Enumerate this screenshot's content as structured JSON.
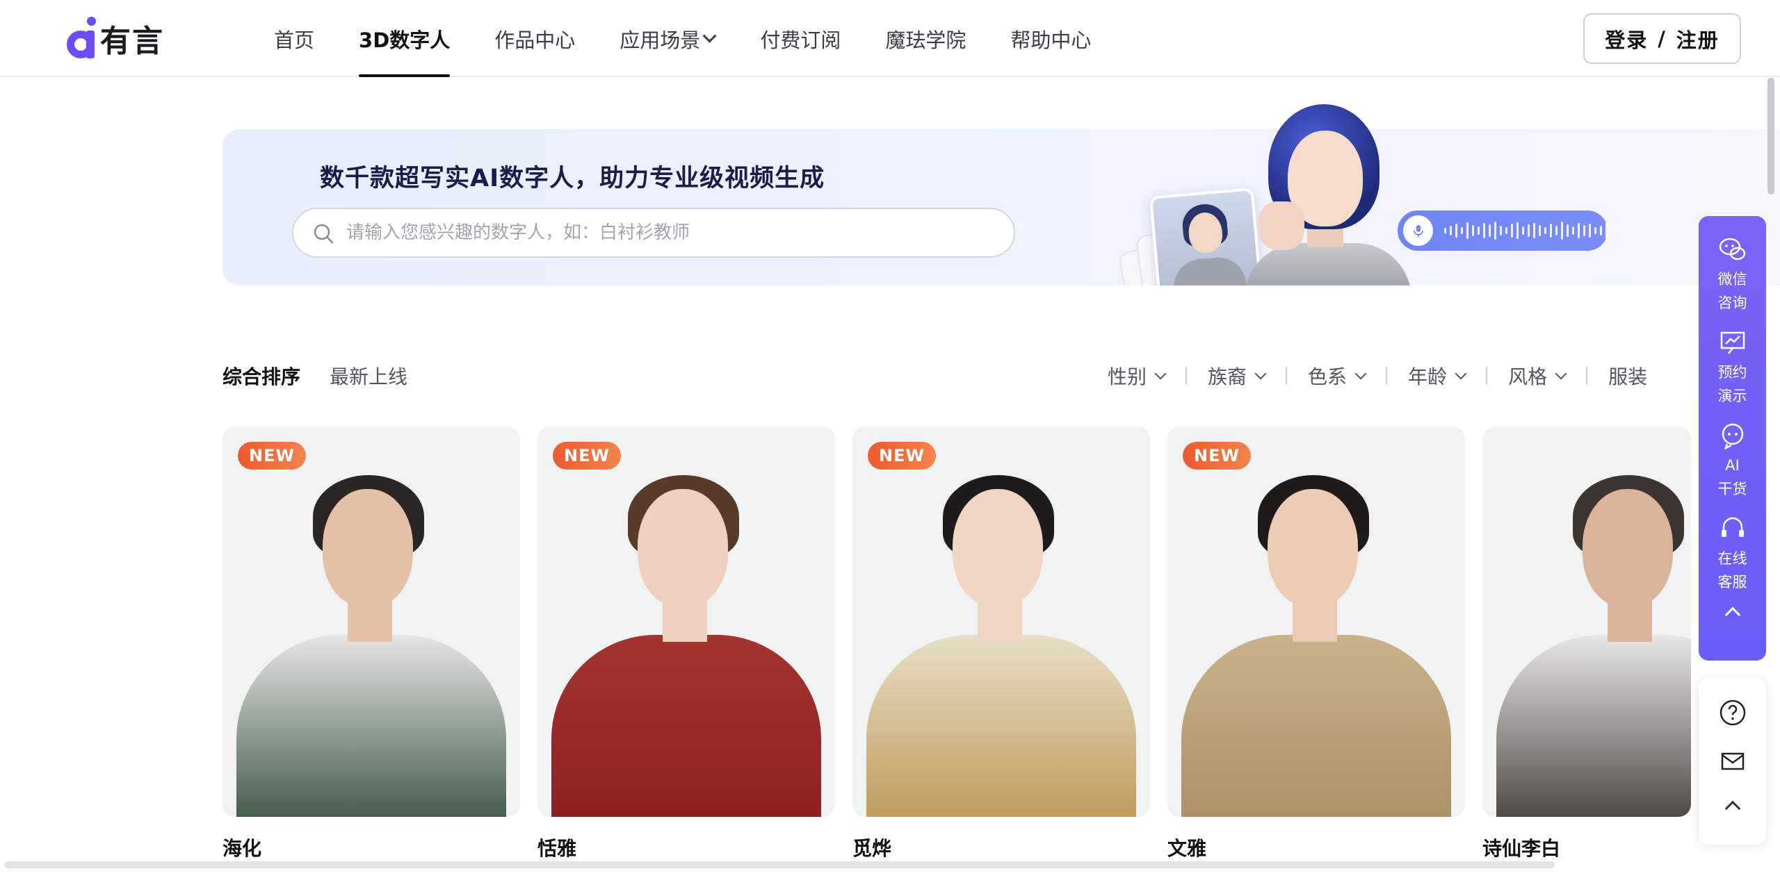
{
  "brand": {
    "name": "有言",
    "accent": "#6d4cf6"
  },
  "nav": {
    "items": [
      {
        "label": "首页",
        "active": false,
        "dropdown": false
      },
      {
        "label": "3D数字人",
        "active": true,
        "dropdown": false
      },
      {
        "label": "作品中心",
        "active": false,
        "dropdown": false
      },
      {
        "label": "应用场景",
        "active": false,
        "dropdown": true
      },
      {
        "label": "付费订阅",
        "active": false,
        "dropdown": false
      },
      {
        "label": "魔珐学院",
        "active": false,
        "dropdown": false
      },
      {
        "label": "帮助中心",
        "active": false,
        "dropdown": false
      }
    ],
    "login": {
      "login_label": "登录",
      "separator": "/",
      "register_label": "注册"
    }
  },
  "banner": {
    "title": "数千款超写实AI数字人，助力专业级视频生成",
    "search": {
      "placeholder": "请输入您感兴趣的数字人，如：白衬衫教师",
      "value": ""
    }
  },
  "sort": {
    "options": [
      {
        "label": "综合排序",
        "active": true
      },
      {
        "label": "最新上线",
        "active": false
      }
    ]
  },
  "filters": [
    "性别",
    "族裔",
    "色系",
    "年龄",
    "风格",
    "服装"
  ],
  "cards": [
    {
      "name": "海化",
      "badge": "NEW",
      "skin": "#e3c0a6",
      "hair": "#2b2623",
      "outfit": "#e6e6e2",
      "accent": "#2d4a3a"
    },
    {
      "name": "恬雅",
      "badge": "NEW",
      "skin": "#efcfbd",
      "hair": "#5a3a28",
      "outfit": "#a33430",
      "accent": "#8a1f20"
    },
    {
      "name": "觅烨",
      "badge": "NEW",
      "skin": "#f1d6c6",
      "hair": "#1e1b1b",
      "outfit": "#e8dfc6",
      "accent": "#b99250"
    },
    {
      "name": "文雅",
      "badge": "NEW",
      "skin": "#eccbb6",
      "hair": "#201a18",
      "outfit": "#c9b28a",
      "accent": "#a88d63"
    },
    {
      "name": "诗仙李白",
      "badge": "",
      "skin": "#d9b49a",
      "hair": "#3b3430",
      "outfit": "#e7e7e5",
      "accent": "#3b3430"
    }
  ],
  "float_bar": {
    "items": [
      {
        "icon": "wechat-chat-icon",
        "line1": "微信",
        "line2": "咨询"
      },
      {
        "icon": "presentation-icon",
        "line1": "预约",
        "line2": "演示"
      },
      {
        "icon": "ai-bot-icon",
        "line1": "AI",
        "line2": "干货"
      },
      {
        "icon": "headset-icon",
        "line1": "在线",
        "line2": "客服"
      }
    ],
    "secondary": [
      "help-circle-icon",
      "mail-icon",
      "back-to-top-icon"
    ]
  }
}
